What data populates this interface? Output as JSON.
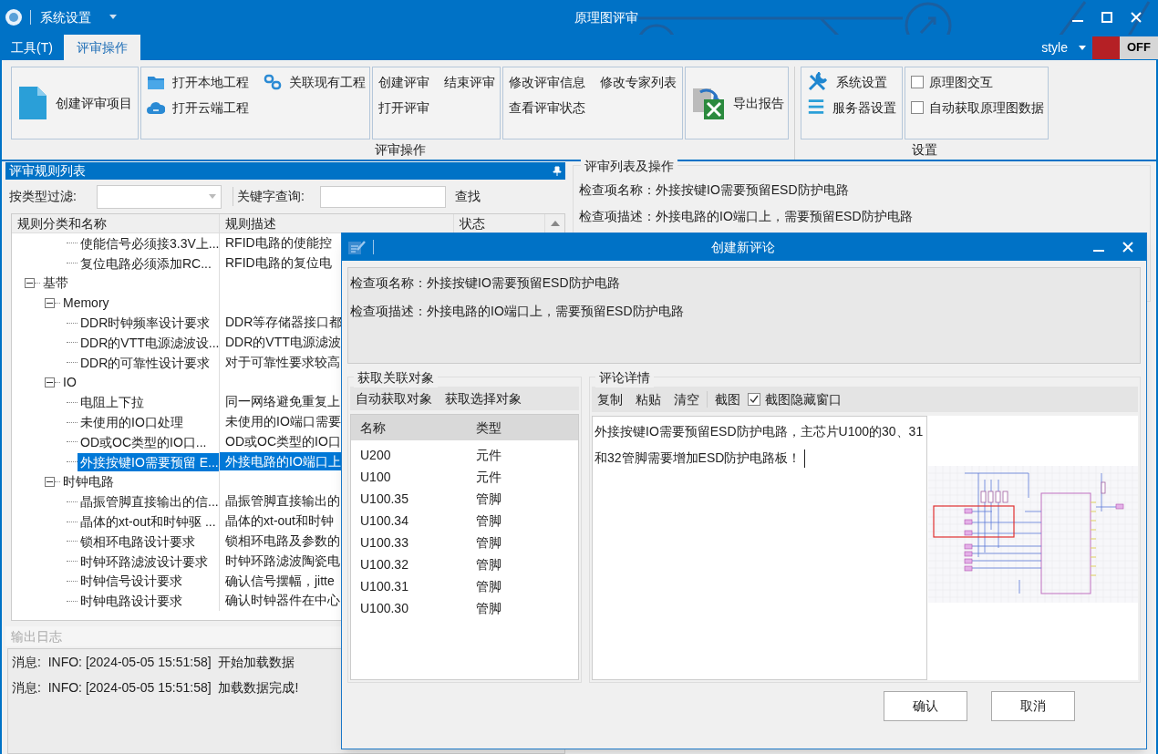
{
  "window": {
    "title": "原理图评审",
    "quick_access": "系统设置"
  },
  "tabs": [
    {
      "label": "工具(T)",
      "selected": false
    },
    {
      "label": "评审操作",
      "selected": true
    }
  ],
  "style_menu": {
    "label": "style",
    "toggle": {
      "label": "OFF",
      "on": false
    }
  },
  "ribbon": {
    "groups": [
      {
        "label": "评审操作",
        "panels": [
          {
            "items": [
              {
                "kind": "large",
                "label": "创建评审项目"
              }
            ]
          },
          {
            "items": [
              {
                "kind": "small",
                "label": "打开本地工程"
              },
              {
                "kind": "small",
                "label": "关联现有工程"
              },
              {
                "kind": "small",
                "label": "打开云端工程"
              }
            ]
          },
          {
            "items": [
              {
                "kind": "text",
                "label": "创建评审"
              },
              {
                "kind": "text",
                "label": "结束评审"
              },
              {
                "kind": "text",
                "label": "打开评审"
              }
            ]
          },
          {
            "items": [
              {
                "kind": "text",
                "label": "修改评审信息"
              },
              {
                "kind": "text",
                "label": "修改专家列表"
              },
              {
                "kind": "text",
                "label": "查看评审状态"
              }
            ]
          },
          {
            "items": [
              {
                "kind": "large",
                "label": "导出报告"
              }
            ]
          }
        ]
      },
      {
        "label": "设置",
        "panels": [
          {
            "items": [
              {
                "kind": "small",
                "label": "系统设置"
              },
              {
                "kind": "small",
                "label": "服务器设置"
              }
            ]
          },
          {
            "items": [
              {
                "kind": "checkbox",
                "label": "原理图交互",
                "checked": false
              },
              {
                "kind": "checkbox",
                "label": "自动获取原理图数据",
                "checked": false
              }
            ]
          }
        ]
      }
    ]
  },
  "rules_panel": {
    "title": "评审规则列表",
    "filter_label": "按类型过滤:",
    "keyword_label": "关键字查询:",
    "search_button": "查找",
    "columns": [
      "规则分类和名称",
      "规则描述",
      "状态"
    ],
    "tree": [
      {
        "children": [
          {
            "children": [
              {
                "label": "使能信号必须接3.3V上...",
                "description": "RFID电路的使能控",
                "selected": false
              },
              {
                "label": "复位电路必须添加RC...",
                "description": "RFID电路的复位电",
                "selected": false
              }
            ]
          }
        ]
      },
      {
        "label": "基带",
        "expanded": true,
        "selected": false,
        "children": [
          {
            "label": "Memory",
            "expanded": true,
            "selected": false,
            "children": [
              {
                "label": "DDR时钟频率设计要求",
                "description": "DDR等存储器接口都",
                "selected": false
              },
              {
                "label": "DDR的VTT电源滤波设...",
                "description": "DDR的VTT电源滤波",
                "selected": false
              },
              {
                "label": "DDR的可靠性设计要求",
                "description": "对于可靠性要求较高",
                "selected": false
              }
            ]
          },
          {
            "label": "IO",
            "expanded": true,
            "selected": false,
            "children": [
              {
                "label": "电阻上下拉",
                "description": "同一网络避免重复上",
                "selected": false
              },
              {
                "label": "未使用的IO口处理",
                "description": "未使用的IO端口需要",
                "selected": false
              },
              {
                "label": "OD或OC类型的IO口...",
                "description": "OD或OC类型的IO口",
                "selected": false
              },
              {
                "label": "外接按键IO需要预留 E...",
                "description": "外接电路的IO端口上",
                "selected": true
              }
            ]
          },
          {
            "label": "时钟电路",
            "expanded": true,
            "selected": false,
            "children": [
              {
                "label": "晶振管脚直接输出的信...",
                "description": "晶振管脚直接输出的",
                "selected": false
              },
              {
                "label": "晶体的xt-out和时钟驱 ...",
                "description": "晶体的xt-out和时钟",
                "selected": false
              },
              {
                "label": "锁相环电路设计要求",
                "description": "锁相环电路及参数的",
                "selected": false
              },
              {
                "label": "时钟环路滤波设计要求",
                "description": "时钟环路滤波陶瓷电",
                "selected": false
              },
              {
                "label": "时钟信号设计要求",
                "description": "确认信号摆幅，jitte",
                "selected": false
              },
              {
                "label": "时钟电路设计要求",
                "description": "确认时钟器件在中心",
                "selected": false
              }
            ]
          }
        ]
      }
    ]
  },
  "output_log": {
    "title": "输出日志",
    "lines": [
      "消息:  INFO: [2024-05-05 15:51:58]  开始加载数据",
      "消息:  INFO: [2024-05-05 15:51:58]  加载数据完成!"
    ]
  },
  "review_panel": {
    "title": "评审列表及操作",
    "item_name": "检查项名称：外接按键IO需要预留ESD防护电路",
    "item_description": "检查项描述：外接电路的IO端口上，需要预留ESD防护电路"
  },
  "dialog": {
    "title": "创建新评论",
    "item_name": "检查项名称：外接按键IO需要预留ESD防护电路",
    "item_description": "检查项描述：外接电路的IO端口上，需要预留ESD防护电路",
    "objects": {
      "title": "获取关联对象",
      "actions": [
        "自动获取对象",
        "获取选择对象"
      ],
      "columns": [
        "名称",
        "类型"
      ],
      "rows": [
        {
          "name": "U200",
          "type": "元件"
        },
        {
          "name": "U100",
          "type": "元件"
        },
        {
          "name": "U100.35",
          "type": "管脚"
        },
        {
          "name": "U100.34",
          "type": "管脚"
        },
        {
          "name": "U100.33",
          "type": "管脚"
        },
        {
          "name": "U100.32",
          "type": "管脚"
        },
        {
          "name": "U100.31",
          "type": "管脚"
        },
        {
          "name": "U100.30",
          "type": "管脚"
        }
      ]
    },
    "comment": {
      "title": "评论详情",
      "actions": [
        "复制",
        "粘贴",
        "清空"
      ],
      "screenshot": "截图",
      "hide_window": {
        "label": "截图隐藏窗口",
        "checked": true
      },
      "text": "外接按键IO需要预留ESD防护电路，主芯片U100的30、31和32管脚需要增加ESD防护电路板！"
    },
    "buttons": [
      "确认",
      "取消"
    ]
  }
}
